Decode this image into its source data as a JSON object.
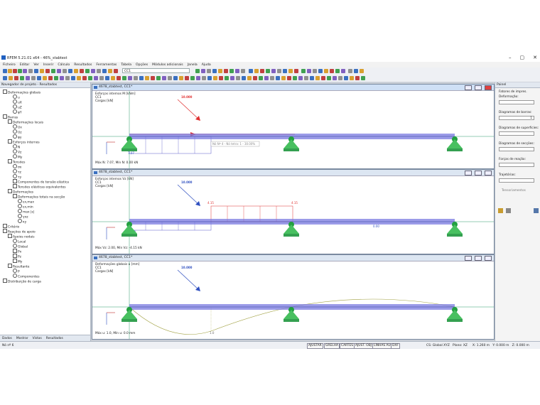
{
  "window": {
    "title": "RFEM 5.21.01 x64 - 46%_stabtest",
    "controls": [
      "–",
      "▢",
      "✕"
    ]
  },
  "menu": [
    "Ficheiro",
    "Editar",
    "Ver",
    "Inserir",
    "Cálculo",
    "Resultados",
    "Ferramentas",
    "Tabela",
    "Opções",
    "Módulos adicionais",
    "Janela",
    "Ajuda"
  ],
  "toolbar": {
    "loadcase_combo": "CC1"
  },
  "navigator": {
    "title": "Navegador de projeto - Resultados",
    "items": [
      {
        "label": "Deformações globais",
        "level": 0,
        "kind": "box"
      },
      {
        "label": "u",
        "level": 2,
        "kind": "radio"
      },
      {
        "label": "uX",
        "level": 2,
        "kind": "radio"
      },
      {
        "label": "uZ",
        "level": 2,
        "kind": "radio"
      },
      {
        "label": "φY",
        "level": 2,
        "kind": "radio"
      },
      {
        "label": "Barras",
        "level": 0,
        "kind": "box"
      },
      {
        "label": "Deformações locais",
        "level": 1,
        "kind": "box"
      },
      {
        "label": "Ux",
        "level": 2,
        "kind": "radio"
      },
      {
        "label": "Uz",
        "level": 2,
        "kind": "radio"
      },
      {
        "label": "φy",
        "level": 2,
        "kind": "radio"
      },
      {
        "label": "Esforços internos",
        "level": 1,
        "kind": "box"
      },
      {
        "label": "N",
        "level": 2,
        "kind": "radio"
      },
      {
        "label": "Vz",
        "level": 2,
        "kind": "radio"
      },
      {
        "label": "My",
        "level": 2,
        "kind": "radio"
      },
      {
        "label": "Tensões",
        "level": 1,
        "kind": "box"
      },
      {
        "label": "σx",
        "level": 2,
        "kind": "radio"
      },
      {
        "label": "τz",
        "level": 2,
        "kind": "radio"
      },
      {
        "label": "τy",
        "level": 2,
        "kind": "radio"
      },
      {
        "label": "Componentes de tensão elástica",
        "level": 2,
        "kind": "box"
      },
      {
        "label": "Tensões elásticas equivalentes",
        "level": 2,
        "kind": "box"
      },
      {
        "label": "Deformações",
        "level": 1,
        "kind": "box"
      },
      {
        "label": "Deformações totais na secção",
        "level": 2,
        "kind": "box"
      },
      {
        "label": "εx,max",
        "level": 3,
        "kind": "radio"
      },
      {
        "label": "εx,min",
        "level": 3,
        "kind": "radio"
      },
      {
        "label": "max |ε|",
        "level": 3,
        "kind": "radio"
      },
      {
        "label": "γxz",
        "level": 3,
        "kind": "radio"
      },
      {
        "label": "κy",
        "level": 3,
        "kind": "radio"
      },
      {
        "label": "Critério",
        "level": 0,
        "kind": "box"
      },
      {
        "label": "Reações de apoio",
        "level": 0,
        "kind": "box"
      },
      {
        "label": "Apoios nodais",
        "level": 1,
        "kind": "box"
      },
      {
        "label": "Local",
        "level": 2,
        "kind": "radio"
      },
      {
        "label": "Global",
        "level": 2,
        "kind": "radio"
      },
      {
        "label": "Px",
        "level": 2,
        "kind": "box"
      },
      {
        "label": "Pz",
        "level": 2,
        "kind": "box"
      },
      {
        "label": "My",
        "level": 2,
        "kind": "box"
      },
      {
        "label": "Resultante",
        "level": 1,
        "kind": "box"
      },
      {
        "label": "P",
        "level": 2,
        "kind": "radio"
      },
      {
        "label": "Componentes",
        "level": 2,
        "kind": "radio"
      },
      {
        "label": "Distribuição de carga",
        "level": 0,
        "kind": "box"
      }
    ],
    "tabs": [
      "Dados",
      "Mostrar",
      "Vistas",
      "Resultados"
    ]
  },
  "windows": [
    {
      "title": "4678_stabtest, CC1*",
      "lines": [
        "Esforços internos M [kNm]",
        "CC1",
        "Cargas [kN]"
      ],
      "load": "10.000",
      "maxmin": "Máx N: 7.07, Mín N: 0.00 kN",
      "tooltip": "Nó Nº 4 - Nó tetra: 1 - 30.00%",
      "values": [
        "7.07"
      ],
      "active": true
    },
    {
      "title": "4678_stabtest, CC1*",
      "lines": [
        "Esforços internos Vz [kN]",
        "CC1",
        "Cargas [kN]"
      ],
      "load": "10.000",
      "maxmin": "Máx Vz: 2.00, Mín Vz: -4.15 kN",
      "values": [
        "4.15",
        "4.15",
        "2.00",
        "0.00"
      ],
      "active": false
    },
    {
      "title": "4678_stabtest, CC1*",
      "lines": [
        "Deformações globais u [mm]",
        "CC1",
        "Cargas [kN]"
      ],
      "load": "10.000",
      "maxmin": "Máx u: 1.0, Mín u: 0.0 mm",
      "values": [
        "1.0"
      ],
      "active": false
    }
  ],
  "panel": {
    "title": "Painel",
    "labels": [
      "Fatores de impres.",
      "Deformação:",
      "Diagramas de barras:",
      "Diagramas de superfícies:",
      "Diagramas de secções:",
      "Forças de reação:",
      "Trajetórias:",
      "Tensoriamentos"
    ],
    "values": [
      "",
      "1"
    ]
  },
  "statusbar": {
    "left": "Nó nº 6",
    "buttons": [
      "AJUSTAR",
      "GRELHA",
      "CARTES",
      "AJUST. OBJ",
      "LINHAS AUX",
      "DXF"
    ],
    "coords": "CS: Global XYZ   Plano: XZ     X: 1.260 m   Y: 0.000 m   Z: 0.000 m"
  },
  "colors": {
    "member": "#7a7ae0",
    "support": "#22a040",
    "diagram": "#e03030",
    "deform": "#a0a040"
  }
}
